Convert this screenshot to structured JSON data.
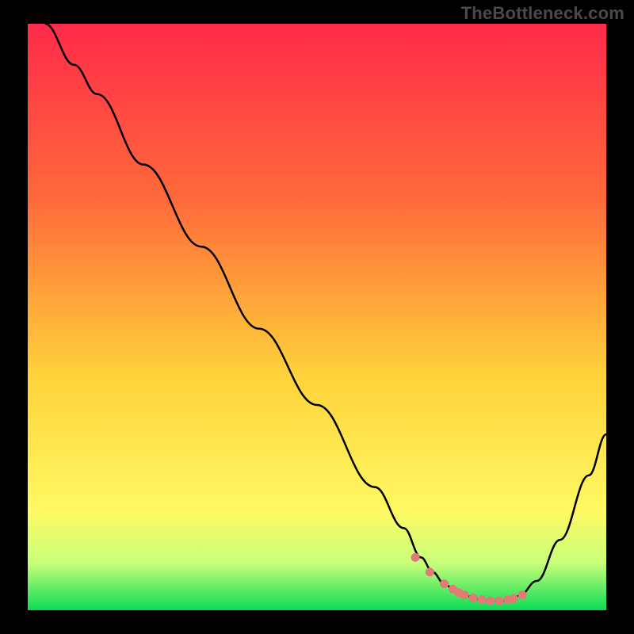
{
  "watermark": "TheBottleneck.com",
  "colors": {
    "bg": "#000000",
    "gradient_top": "#ff2a4a",
    "gradient_mid1": "#ff6a3a",
    "gradient_mid2": "#ffd23a",
    "gradient_mid3": "#fff963",
    "gradient_bottom": "#0bdc55",
    "curve": "#000000",
    "marker_fill": "#e27a76",
    "marker_stroke": "#cf5f59"
  },
  "chart_data": {
    "type": "line",
    "title": "",
    "xlabel": "",
    "ylabel": "",
    "xlim": [
      0,
      100
    ],
    "ylim": [
      0,
      100
    ],
    "grid": false,
    "legend": false,
    "series": [
      {
        "name": "bottleneck-curve",
        "x": [
          3,
          8,
          12,
          20,
          30,
          40,
          50,
          60,
          65,
          68,
          70,
          72,
          74,
          76,
          78,
          80,
          82,
          84,
          85,
          88,
          92,
          97,
          100
        ],
        "y": [
          100,
          93,
          88,
          76,
          62,
          48,
          35,
          21,
          14,
          9,
          6.5,
          4.5,
          3.2,
          2.4,
          1.9,
          1.6,
          1.6,
          2.0,
          2.5,
          5,
          12,
          23,
          30
        ]
      }
    ],
    "markers": {
      "name": "highlight-points",
      "x": [
        67,
        69.5,
        72,
        73.5,
        74.5,
        75.5,
        77,
        78.5,
        80,
        81.5,
        83,
        84,
        85.5
      ],
      "y": [
        9,
        6.5,
        4.5,
        3.6,
        3.0,
        2.6,
        2.1,
        1.8,
        1.6,
        1.6,
        1.8,
        2.0,
        2.6
      ]
    }
  }
}
